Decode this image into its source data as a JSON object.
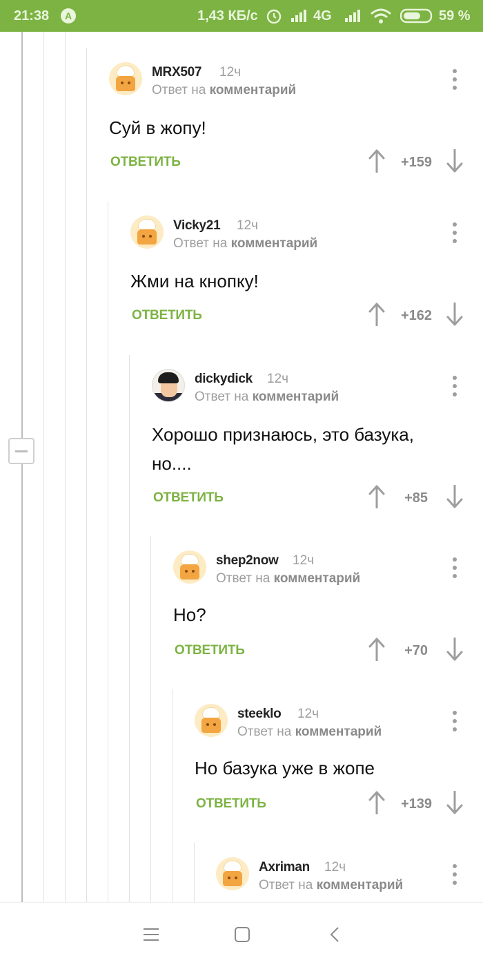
{
  "status_bar": {
    "time": "21:38",
    "network_speed": "1,43 КБ/с",
    "network_type": "4G",
    "battery": "59 %",
    "accent_color": "#7cb342"
  },
  "labels": {
    "reply_prefix": "Ответ на",
    "reply_target": "комментарий",
    "reply_button": "ОТВЕТИТЬ"
  },
  "comments": [
    {
      "user": "MRX507",
      "time": "12ч",
      "text": "Суй в жопу!",
      "rating": "+159",
      "avatar": "default-chef"
    },
    {
      "user": "Vicky21",
      "time": "12ч",
      "text": "Жми на кнопку!",
      "rating": "+162",
      "avatar": "default-chef"
    },
    {
      "user": "dickydick",
      "time": "12ч",
      "text": "Хорошо признаюсь, это базука,",
      "text2": "но....",
      "rating": "+85",
      "avatar": "user-photo"
    },
    {
      "user": "shep2now",
      "time": "12ч",
      "text": "Но?",
      "rating": "+70",
      "avatar": "default-chef"
    },
    {
      "user": "steeklo",
      "time": "12ч",
      "text": "Но базука уже в жопе",
      "rating": "+139",
      "avatar": "default-chef"
    },
    {
      "user": "Axriman",
      "time": "12ч",
      "avatar": "default-chef"
    }
  ],
  "nav": {
    "menu_icon": "menu-icon",
    "home_icon": "home-square-icon",
    "back_icon": "back-chevron-icon"
  }
}
